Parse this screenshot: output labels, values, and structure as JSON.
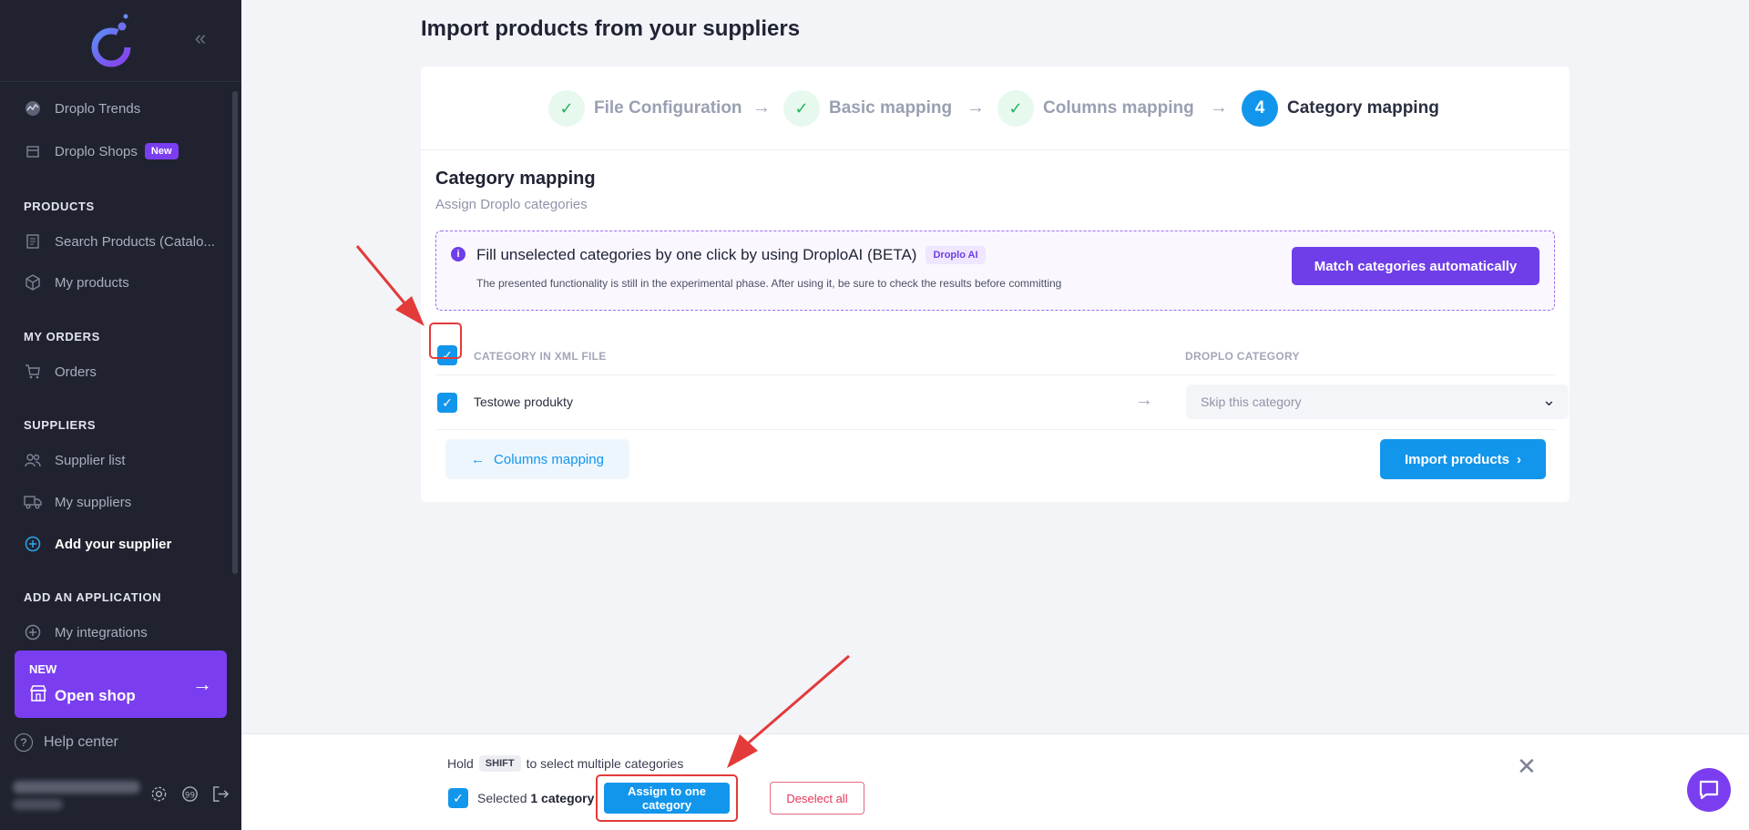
{
  "sidebar": {
    "items": {
      "trends": "Droplo Trends",
      "shops": "Droplo Shops",
      "shops_badge": "New",
      "search_products": "Search Products (Catalo...",
      "my_products": "My products",
      "orders": "Orders",
      "supplier_list": "Supplier list",
      "my_suppliers": "My suppliers",
      "add_supplier": "Add your supplier",
      "my_integrations": "My integrations"
    },
    "sections": {
      "products": "PRODUCTS",
      "my_orders": "MY ORDERS",
      "suppliers": "SUPPLIERS",
      "add_application": "ADD AN APPLICATION"
    },
    "open_shop": {
      "new": "NEW",
      "label": "Open shop"
    },
    "help": "Help center"
  },
  "page": {
    "title": "Import products from your suppliers"
  },
  "stepper": {
    "steps": [
      {
        "label": "File Configuration",
        "state": "done"
      },
      {
        "label": "Basic mapping",
        "state": "done"
      },
      {
        "label": "Columns mapping",
        "state": "done"
      },
      {
        "label": "Category mapping",
        "state": "active",
        "number": "4"
      }
    ]
  },
  "section": {
    "title": "Category mapping",
    "subtitle": "Assign Droplo categories"
  },
  "ai": {
    "title": "Fill unselected categories by one click by using DroploAI (BETA)",
    "tag": "Droplo AI",
    "note": "The presented functionality is still in the experimental phase. After using it, be sure to check the results before committing",
    "button": "Match categories automatically"
  },
  "table": {
    "col_xml": "CATEGORY IN XML FILE",
    "col_droplo": "DROPLO CATEGORY",
    "rows": [
      {
        "name": "Testowe produkty",
        "selected": "Skip this category"
      }
    ]
  },
  "actions": {
    "back": "Columns mapping",
    "import": "Import products"
  },
  "bottom": {
    "hold_pre": "Hold",
    "kbd": "SHIFT",
    "hold_post": "to select multiple categories",
    "selected_pre": "Selected",
    "selected_count": "1 category",
    "assign": "Assign to one category",
    "deselect": "Deselect all"
  },
  "colors": {
    "accent_blue": "#1296ec",
    "accent_purple": "#7a3ef0",
    "sidebar_bg": "#20232f",
    "annotation_red": "#e33a3a"
  }
}
